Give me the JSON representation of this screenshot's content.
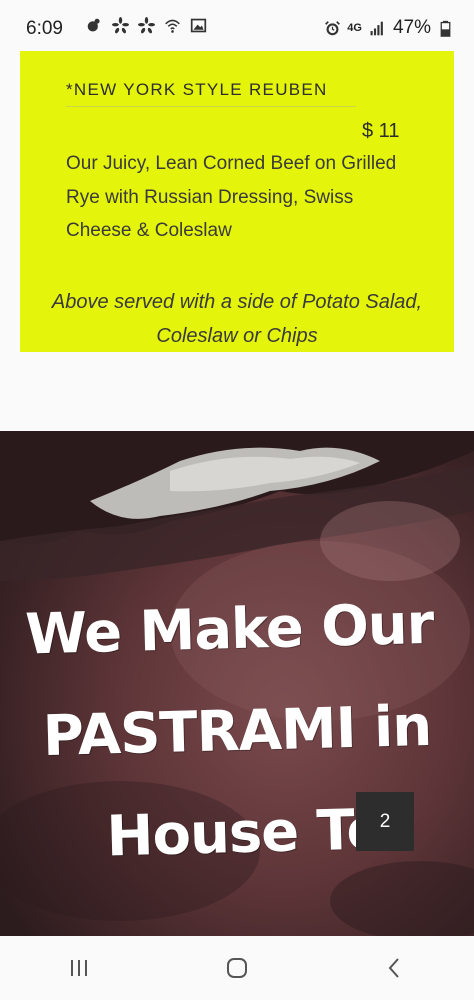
{
  "status_bar": {
    "time": "6:09",
    "left_icons": [
      "notification-icon",
      "yelp-icon",
      "yelp-icon",
      "wifi-icon",
      "image-icon"
    ],
    "right_icons": [
      "alarm-icon",
      "4g-lte-icon",
      "signal-icon"
    ],
    "network": "4G",
    "battery": "47%"
  },
  "menu_card": {
    "background": "#e4f40a",
    "item_title": "*NEW YORK STYLE REUBEN",
    "item_price": "$ 11",
    "item_description": "Our Juicy, Lean Corned Beef on Grilled Rye with Russian Dressing, Swiss Cheese & Coleslaw",
    "sides_note": "Above served with a side of Potato Salad, Coleslaw or Chips"
  },
  "hero": {
    "line_1": "We Make Our",
    "line_2": "PASTRAMI in",
    "line_3": "House Toi",
    "page_badge": "2"
  },
  "nav_bar": {
    "buttons": [
      "recent-apps-icon",
      "home-icon",
      "back-icon"
    ]
  }
}
